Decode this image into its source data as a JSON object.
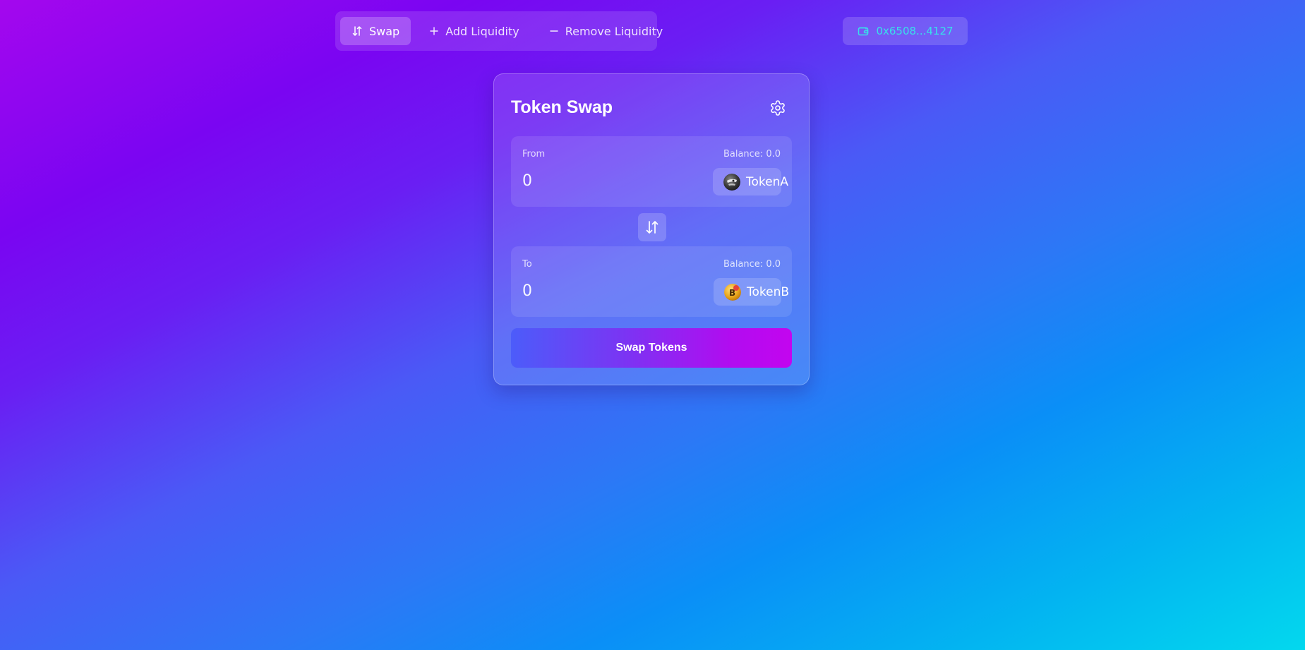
{
  "tabs": [
    {
      "label": "Swap",
      "icon": "swap-arrows-icon",
      "active": true
    },
    {
      "label": "Add Liquidity",
      "icon": "plus-icon",
      "active": false
    },
    {
      "label": "Remove Liquidity",
      "icon": "minus-icon",
      "active": false
    }
  ],
  "wallet": {
    "address": "0x6508...4127",
    "icon": "wallet-icon",
    "color": "#38e0ea"
  },
  "card": {
    "title": "Token Swap",
    "settings_icon": "gear-icon"
  },
  "from": {
    "label": "From",
    "balance": "Balance: 0.0",
    "amount_placeholder": "0",
    "token": "TokenA"
  },
  "to": {
    "label": "To",
    "balance": "Balance: 0.0",
    "amount_placeholder": "0",
    "token": "TokenB"
  },
  "flip_icon": "swap-vertical-icon",
  "swap_button": "Swap Tokens",
  "colors": {
    "button_gradient_start": "#4c5cfa",
    "button_gradient_end": "#c305ef",
    "wallet_text": "#38e0ea"
  }
}
